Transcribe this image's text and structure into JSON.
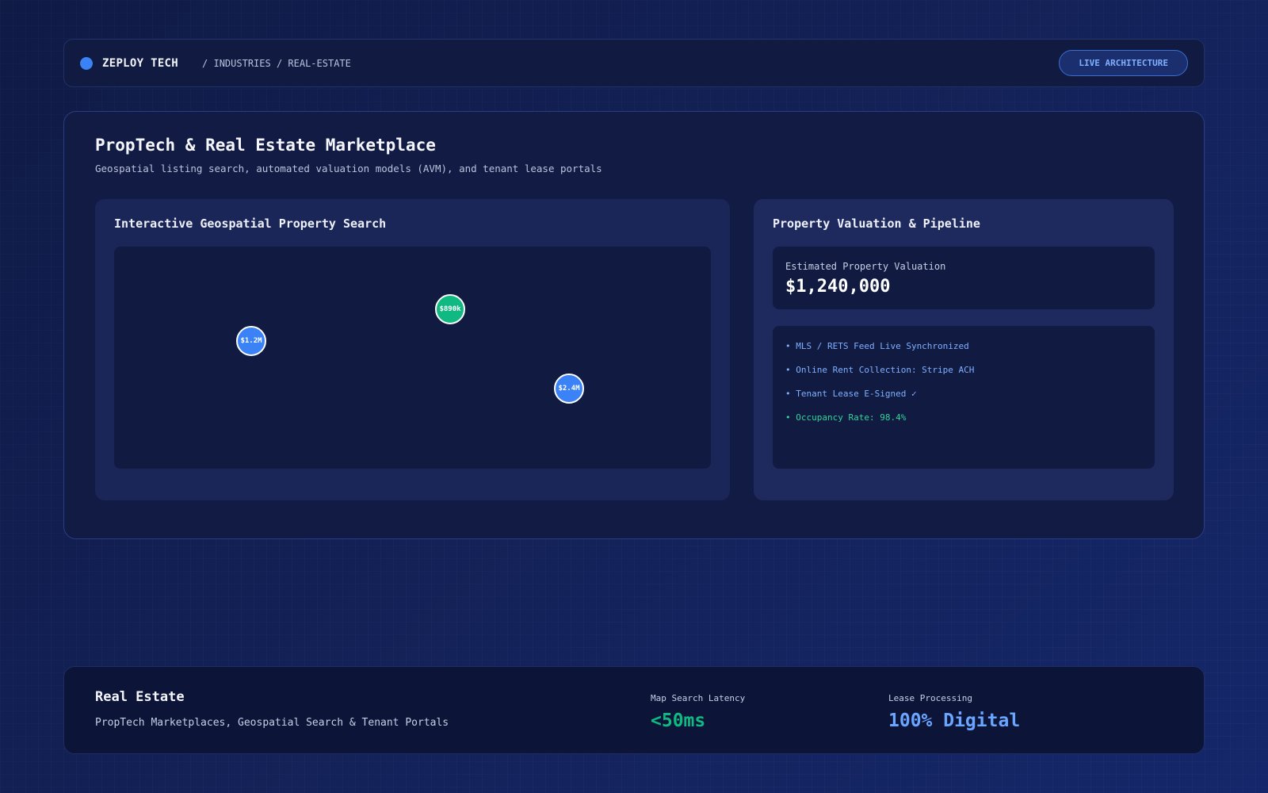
{
  "header": {
    "brand": "ZEPLOY TECH",
    "breadcrumb": "/ INDUSTRIES / REAL-ESTATE",
    "live_button": "LIVE ARCHITECTURE"
  },
  "main": {
    "title": "PropTech & Real Estate Marketplace",
    "subtitle": "Geospatial listing search, automated valuation models (AVM), and tenant lease portals"
  },
  "map_panel": {
    "title": "Interactive Geospatial Property Search",
    "pins": [
      {
        "label": "$1.2M",
        "color": "blue"
      },
      {
        "label": "$890k",
        "color": "green"
      },
      {
        "label": "$2.4M",
        "color": "blue"
      }
    ]
  },
  "valuation_panel": {
    "title": "Property Valuation & Pipeline",
    "valuation_label": "Estimated Property Valuation",
    "valuation_value": "$1,240,000",
    "status_items": [
      "• MLS / RETS Feed Live Synchronized",
      "• Online Rent Collection: Stripe ACH",
      "• Tenant Lease E-Signed ✓",
      "• Occupancy Rate: 98.4%"
    ]
  },
  "footer": {
    "title": "Real Estate",
    "subtitle": "PropTech Marketplaces, Geospatial Search & Tenant Portals",
    "metrics": [
      {
        "label": "Map Search Latency",
        "value": "<50ms"
      },
      {
        "label": "Lease Processing",
        "value": "100% Digital"
      }
    ]
  },
  "colors": {
    "accent_blue": "#3b82f6",
    "accent_green": "#10b981",
    "background": "#14225a"
  }
}
